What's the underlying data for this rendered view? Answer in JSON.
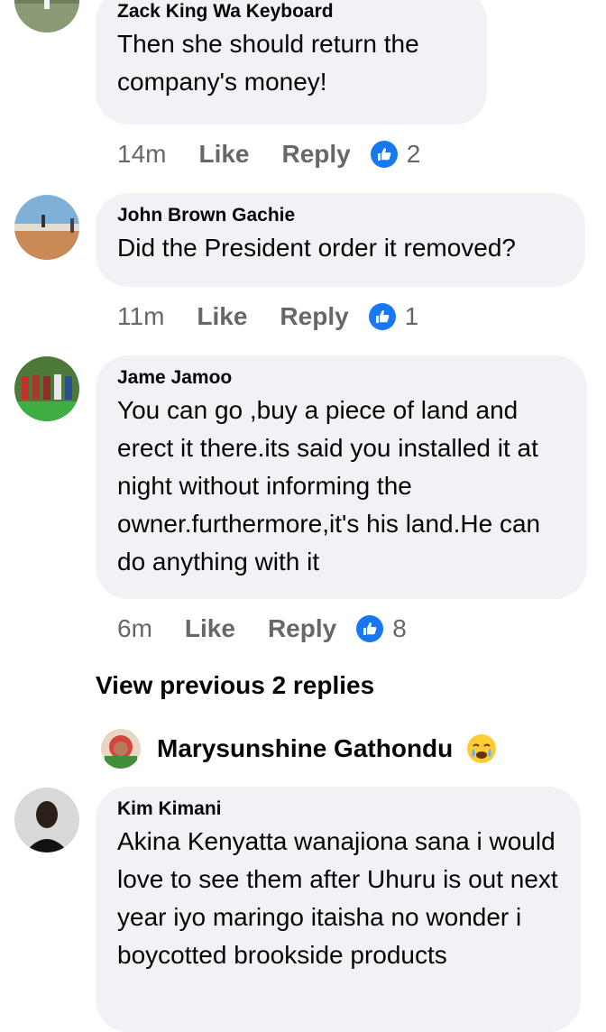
{
  "comments": [
    {
      "author": "Zack King Wa Keyboard",
      "text": "Then  she should return the company's money!",
      "time": "14m",
      "like_label": "Like",
      "reply_label": "Reply",
      "reactions": "2"
    },
    {
      "author": "John Brown Gachie",
      "text": "Did the President order it removed?",
      "time": "11m",
      "like_label": "Like",
      "reply_label": "Reply",
      "reactions": "1"
    },
    {
      "author": "Jame Jamoo",
      "text": "You can go ,buy a piece of land and erect it there.its said you installed it at night without informing the owner.furthermore,it's his land.He can do anything with it",
      "time": "6m",
      "like_label": "Like",
      "reply_label": "Reply",
      "reactions": "8"
    },
    {
      "author": "Kim Kimani",
      "text": "Akina Kenyatta wanajiona sana i would love to see them after Uhuru is out next year iyo maringo itaisha no wonder i boycotted brookside products"
    }
  ],
  "view_previous": "View previous 2 replies",
  "shared_by": {
    "name": "Marysunshine Gathondu",
    "emoji_icon": "crying-face-emoji"
  },
  "colors": {
    "bubble": "#f0f2f5",
    "meta": "#65676b",
    "like_blue": "#1877f2"
  }
}
